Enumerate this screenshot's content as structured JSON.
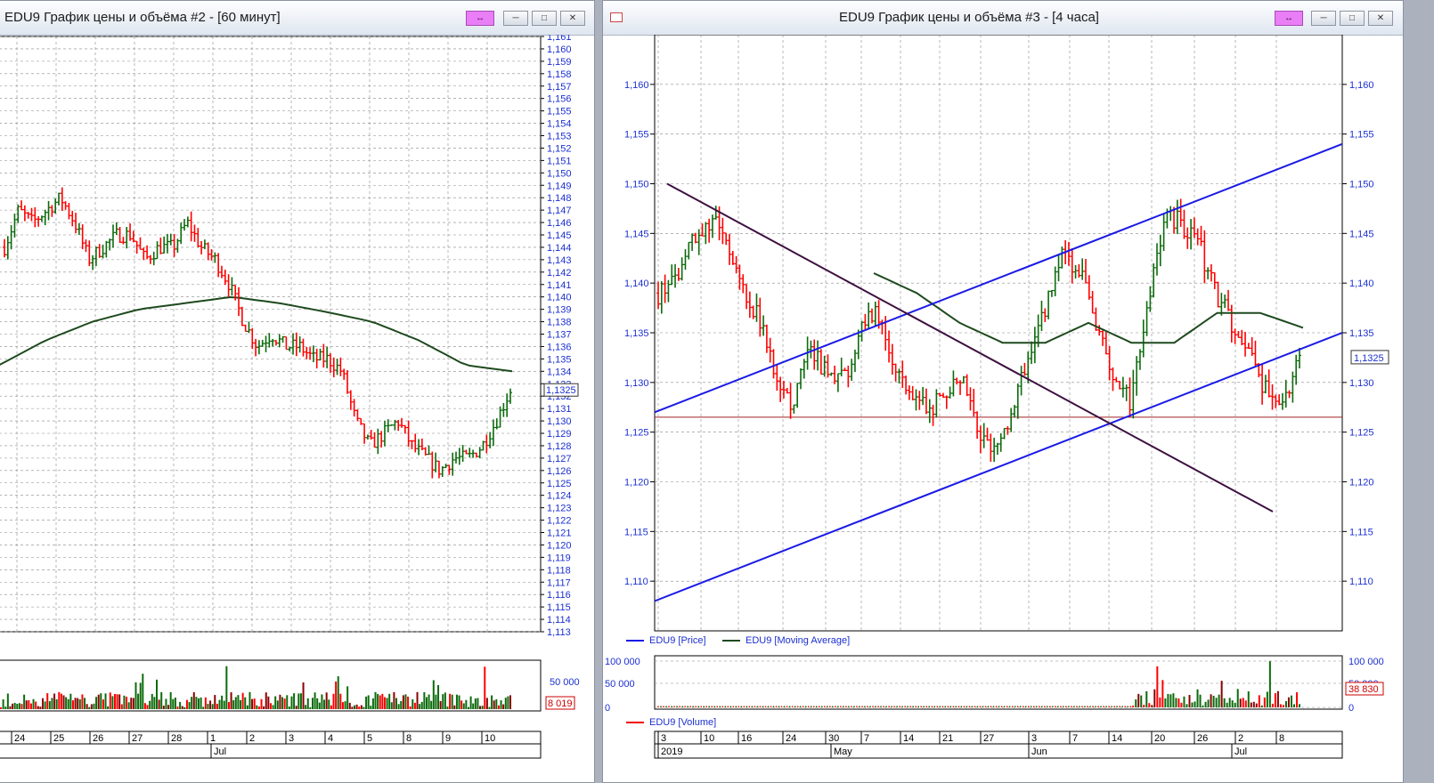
{
  "window_left": {
    "title": "EDU9 График цены и объёма #2 - [60 минут]",
    "last_price_label": "1,1325",
    "volume_last_label": "8 019",
    "volume_tick": "50 000",
    "month_label": "Jul",
    "buttons": {
      "link": "link-icon",
      "minimize": "minimize-icon",
      "restore": "restore-icon",
      "close": "close-icon"
    }
  },
  "window_right": {
    "title": "EDU9 График цены и объёма #3 - [4 часа]",
    "last_price_label": "1,1325",
    "volume_last_label": "38 830",
    "legend_price": "EDU9 [Price]",
    "legend_ma": "EDU9 [Moving Average]",
    "legend_volume": "EDU9 [Volume]",
    "volume_ticks": [
      "100 000",
      "50 000",
      "0"
    ],
    "year_label": "2019",
    "month_labels": [
      "May",
      "Jun",
      "Jul"
    ],
    "buttons": {
      "link": "link-icon",
      "minimize": "minimize-icon",
      "restore": "restore-icon",
      "close": "close-icon"
    }
  },
  "colors": {
    "up": "#0c6b0c",
    "down": "#ff0000",
    "trend": "#1a1ae6",
    "downtrend": "#3d1040",
    "ma": "#1e4a1e",
    "support": "#a02020",
    "volume_dark": "#8b0000"
  },
  "chart_data": [
    {
      "type": "line",
      "title": "EDU9 График цены и объёма #2 - [60 минут]",
      "ylim": [
        1.113,
        1.161
      ],
      "y_tick_labels": [
        "1,161",
        "1,160",
        "1,159",
        "1,158",
        "1,157",
        "1,156",
        "1,155",
        "1,154",
        "1,153",
        "1,152",
        "1,151",
        "1,150",
        "1,149",
        "1,148",
        "1,147",
        "1,146",
        "1,145",
        "1,144",
        "1,143",
        "1,142",
        "1,141",
        "1,140",
        "1,139",
        "1,138",
        "1,137",
        "1,136",
        "1,135",
        "1,134",
        "1,133",
        "1,132",
        "1,131",
        "1,130",
        "1,129",
        "1,128",
        "1,127",
        "1,126",
        "1,125",
        "1,124",
        "1,123",
        "1,122",
        "1,121",
        "1,120",
        "1,119",
        "1,118",
        "1,117",
        "1,116",
        "1,115",
        "1,114",
        "1,113"
      ],
      "x_tick_labels": [
        "24",
        "25",
        "26",
        "27",
        "28",
        "1",
        "2",
        "3",
        "4",
        "5",
        "8",
        "9",
        "10"
      ],
      "series": [
        {
          "name": "Price",
          "values": [
            1.144,
            1.147,
            1.146,
            1.147,
            1.148,
            1.146,
            1.143,
            1.144,
            1.145,
            1.145,
            1.143,
            1.144,
            1.144,
            1.146,
            1.144,
            1.143,
            1.141,
            1.138,
            1.136,
            1.137,
            1.136,
            1.136,
            1.135,
            1.135,
            1.134,
            1.13,
            1.128,
            1.129,
            1.13,
            1.128,
            1.127,
            1.126,
            1.127,
            1.127,
            1.128,
            1.13,
            1.1325
          ]
        },
        {
          "name": "Moving Average",
          "values": [
            1.1345,
            1.1365,
            1.138,
            1.139,
            1.1395,
            1.14,
            1.1395,
            1.1388,
            1.138,
            1.1365,
            1.1345,
            1.134
          ]
        }
      ]
    },
    {
      "type": "line",
      "title": "EDU9 График цены и объёма #3 - [4 часа]",
      "ylim": [
        1.105,
        1.165
      ],
      "y_tick_labels": [
        "1,160",
        "1,155",
        "1,150",
        "1,145",
        "1,140",
        "1,135",
        "1,130",
        "1,125",
        "1,120",
        "1,115",
        "1,110"
      ],
      "x_tick_labels": [
        "3",
        "10",
        "16",
        "24",
        "30",
        "7",
        "14",
        "21",
        "27",
        "3",
        "7",
        "14",
        "20",
        "26",
        "2",
        "8"
      ],
      "series": [
        {
          "name": "EDU9 [Price]",
          "values": [
            1.139,
            1.14,
            1.144,
            1.146,
            1.145,
            1.14,
            1.136,
            1.13,
            1.128,
            1.133,
            1.131,
            1.13,
            1.136,
            1.137,
            1.132,
            1.129,
            1.127,
            1.129,
            1.131,
            1.124,
            1.123,
            1.127,
            1.133,
            1.138,
            1.143,
            1.141,
            1.136,
            1.13,
            1.128,
            1.138,
            1.147,
            1.146,
            1.144,
            1.139,
            1.136,
            1.134,
            1.129,
            1.127,
            1.1325
          ]
        },
        {
          "name": "EDU9 [Moving Average]",
          "values": [
            1.141,
            1.139,
            1.136,
            1.134,
            1.134,
            1.136,
            1.134,
            1.134,
            1.137,
            1.137,
            1.1355
          ]
        }
      ],
      "trendlines": [
        {
          "name": "lower-channel",
          "from": [
            0,
            1.108
          ],
          "to": [
            1,
            1.135
          ]
        },
        {
          "name": "upper-channel",
          "from": [
            0,
            1.127
          ],
          "to": [
            1,
            1.154
          ]
        },
        {
          "name": "downtrend",
          "from": [
            0.02,
            1.15
          ],
          "to": [
            0.89,
            1.117
          ]
        },
        {
          "name": "support",
          "value": 1.1265
        }
      ]
    }
  ]
}
